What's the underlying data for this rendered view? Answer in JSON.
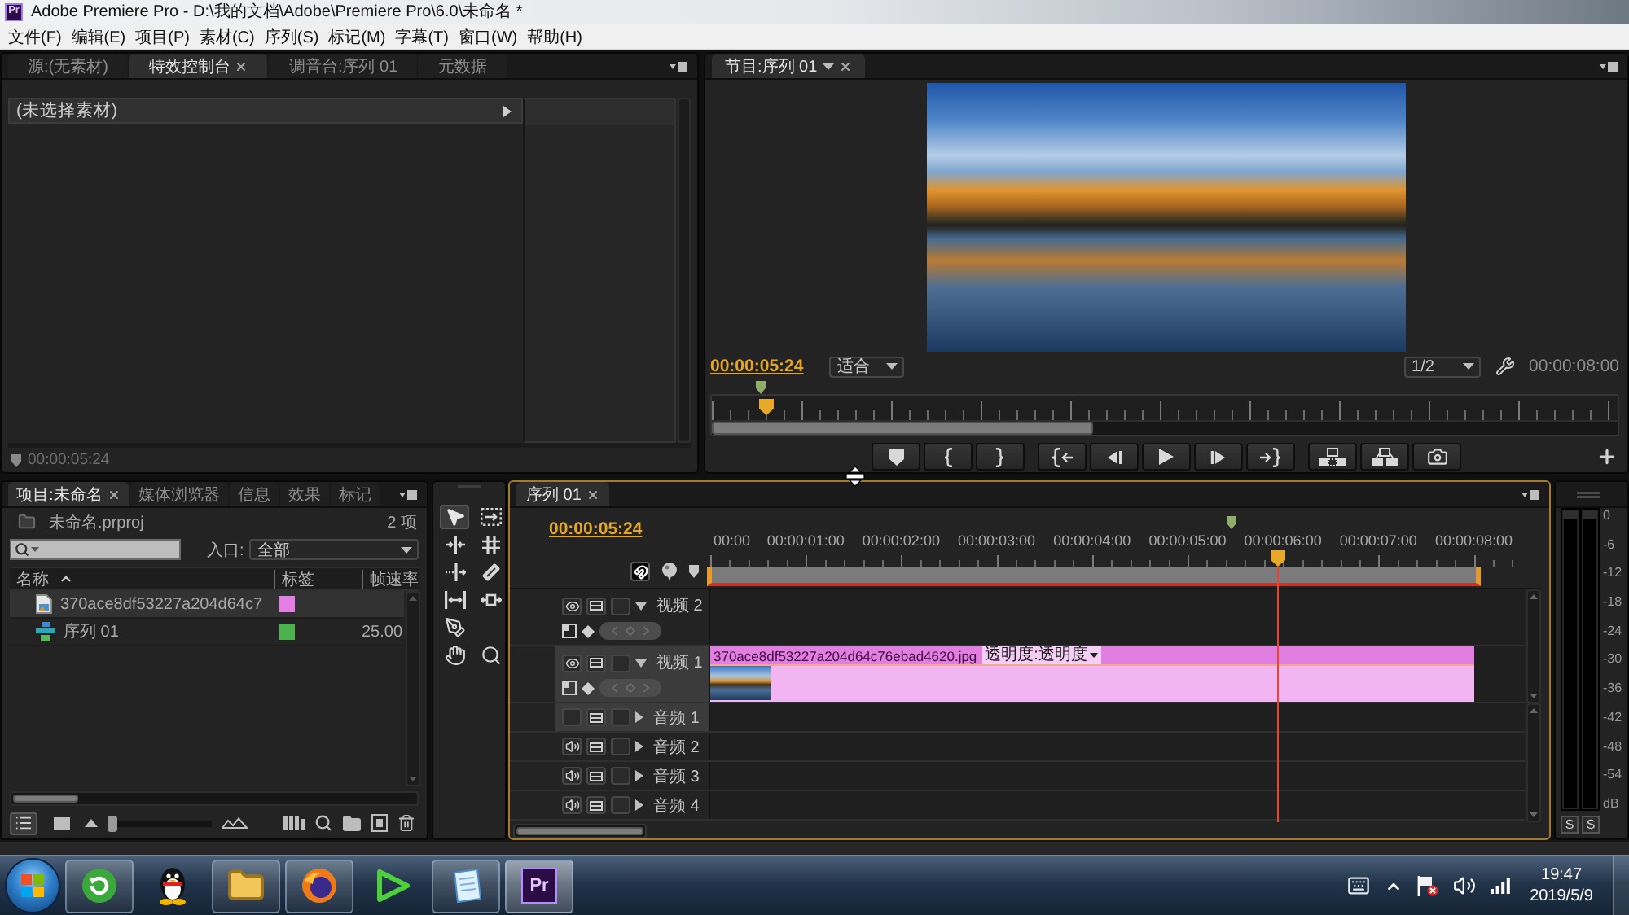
{
  "window": {
    "logo": "Pr",
    "title": "Adobe Premiere Pro - D:\\我的文档\\Adobe\\Premiere Pro\\6.0\\未命名 *"
  },
  "menu": [
    "文件(F)",
    "编辑(E)",
    "项目(P)",
    "素材(C)",
    "序列(S)",
    "标记(M)",
    "字幕(T)",
    "窗口(W)",
    "帮助(H)"
  ],
  "effect_controls": {
    "tabs": [
      {
        "label": "源:(无素材)",
        "selected": false,
        "closable": false
      },
      {
        "label": "特效控制台",
        "selected": true,
        "closable": true
      },
      {
        "label": "调音台:序列 01",
        "selected": false,
        "closable": false
      },
      {
        "label": "元数据",
        "selected": false,
        "closable": false
      }
    ],
    "clip_header": "(未选择素材)",
    "timecode": "00:00:05:24"
  },
  "program_monitor": {
    "tab": {
      "label": "节目:序列 01",
      "selected": true,
      "closable": true
    },
    "timecode": "00:00:05:24",
    "zoom": "适合",
    "resolution": "1/2",
    "duration": "00:00:08:00",
    "playhead": {
      "level": 0.059
    }
  },
  "project": {
    "tabs": [
      {
        "label": "项目:未命名",
        "selected": true,
        "closable": true
      },
      {
        "label": "媒体浏览器",
        "selected": false,
        "closable": false
      },
      {
        "label": "信息",
        "selected": false,
        "closable": false
      },
      {
        "label": "效果",
        "selected": false,
        "closable": false
      },
      {
        "label": "标记",
        "selected": false,
        "closable": false
      }
    ],
    "file": "未命名.prproj",
    "count": "2 项",
    "entry_label": "入口:",
    "entry_value": "全部",
    "columns": [
      "名称",
      "标签",
      "帧速率"
    ],
    "rows": [
      {
        "kind": "image",
        "name": "370ace8df53227a204d64c7",
        "color": "#e37fe3",
        "selected": true
      },
      {
        "kind": "sequence",
        "name": "序列 01",
        "color": "#4fb04f",
        "frame_rate": "25.00",
        "selected": false
      }
    ],
    "views": [
      {
        "kind": "list",
        "selected": true
      },
      {
        "kind": "icon",
        "selected": false
      }
    ],
    "zoom_slider": {
      "level": 0
    }
  },
  "tools": [
    {
      "kind": "selection",
      "selected": true
    },
    {
      "kind": "track_select",
      "selected": false
    },
    {
      "kind": "ripple",
      "selected": false
    },
    {
      "kind": "rolling",
      "selected": false
    },
    {
      "kind": "rate_stretch",
      "selected": false
    },
    {
      "kind": "razor",
      "selected": false
    },
    {
      "kind": "slip",
      "selected": false
    },
    {
      "kind": "slide",
      "selected": false
    },
    {
      "kind": "pen",
      "selected": false
    },
    {
      "kind": "hand",
      "selected": false
    },
    {
      "kind": "zoom",
      "selected": false
    }
  ],
  "timeline": {
    "tab": {
      "label": "序列 01",
      "selected": true,
      "closable": true
    },
    "focused": true,
    "timecode": "00:00:05:24",
    "snap_on": true,
    "ruler": [
      "00:00",
      "00:00:01:00",
      "00:00:02:00",
      "00:00:03:00",
      "00:00:04:00",
      "00:00:05:00",
      "00:00:06:00",
      "00:00:07:00",
      "00:00:08:00"
    ],
    "playhead": {
      "level": 0.696
    },
    "tracks": [
      {
        "kind": "video",
        "name": "视频 2",
        "enabled": true,
        "expanded": true,
        "selected": false
      },
      {
        "kind": "video",
        "name": "视频 1",
        "enabled": true,
        "expanded": true,
        "selected": true,
        "clip": {
          "name": "370ace8df53227a204d64c76ebad4620.jpg",
          "effect": "透明度:透明度"
        }
      },
      {
        "kind": "audio",
        "name": "音频 1",
        "enabled": false,
        "expanded": false,
        "selected": true
      },
      {
        "kind": "audio",
        "name": "音频 2",
        "enabled": true,
        "expanded": false,
        "selected": false
      },
      {
        "kind": "audio",
        "name": "音频 3",
        "enabled": true,
        "expanded": false,
        "selected": false
      },
      {
        "kind": "audio",
        "name": "音频 4",
        "enabled": true,
        "expanded": false,
        "selected": false
      }
    ]
  },
  "audio_meter": {
    "scale": [
      "0",
      "-6",
      "-12",
      "-18",
      "-24",
      "-30",
      "-36",
      "-42",
      "-48",
      "-54",
      "dB"
    ],
    "solo": [
      "S",
      "S"
    ]
  },
  "taskbar": {
    "apps": [
      {
        "kind": "circle_arrow",
        "running": true,
        "selected": false
      },
      {
        "kind": "penguin",
        "running": false,
        "selected": false
      },
      {
        "kind": "folder",
        "running": true,
        "selected": false
      },
      {
        "kind": "globe",
        "running": true,
        "selected": false
      },
      {
        "kind": "triangle",
        "running": false,
        "selected": false
      },
      {
        "kind": "notepad",
        "running": true,
        "selected": false
      },
      {
        "kind": "premiere",
        "label": "Pr",
        "running": true,
        "selected": true
      }
    ],
    "time": "19:47",
    "date": "2019/5/9"
  }
}
